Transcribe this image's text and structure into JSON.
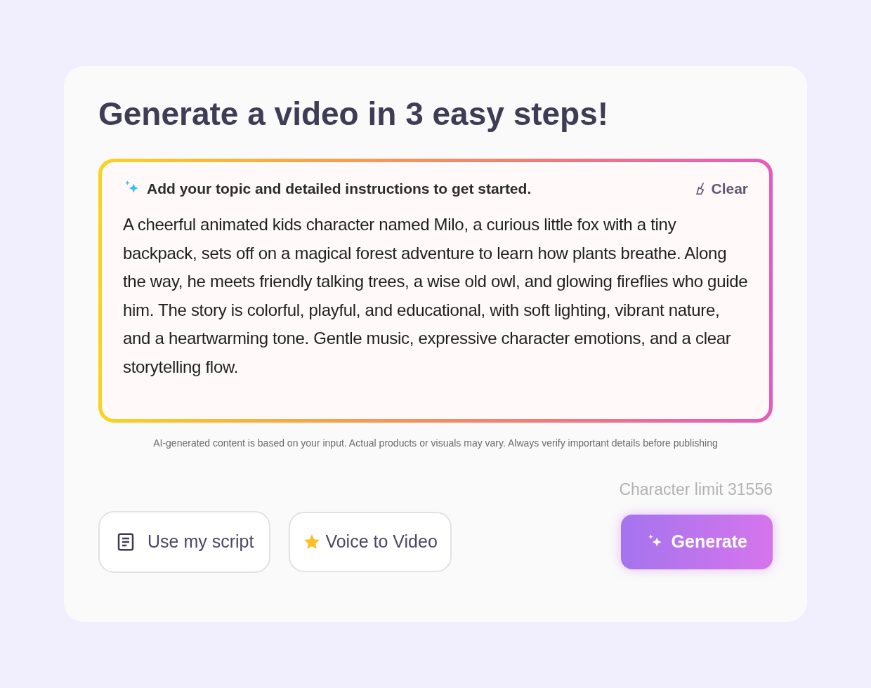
{
  "title": "Generate a video in 3 easy steps!",
  "prompt": {
    "label": "Add your topic and detailed instructions to get started.",
    "clear": "Clear",
    "value": "A cheerful animated kids character named Milo, a curious little fox with a tiny backpack, sets off on a magical forest adventure to learn how plants breathe. Along the way, he meets friendly talking trees, a wise old owl, and glowing fireflies who guide him. The story is colorful, playful, and educational, with soft lighting, vibrant nature, and a heartwarming tone. Gentle music, expressive character emotions, and a clear storytelling flow."
  },
  "disclaimer": "AI-generated content is based on your input. Actual products or visuals may vary. Always verify important details before publishing",
  "character_limit": "Character limit 31556",
  "buttons": [
    {
      "kind": "script",
      "label": "Use my script"
    },
    {
      "kind": "voice",
      "label": "Voice to Video"
    },
    {
      "kind": "generate",
      "label": "Generate"
    }
  ]
}
